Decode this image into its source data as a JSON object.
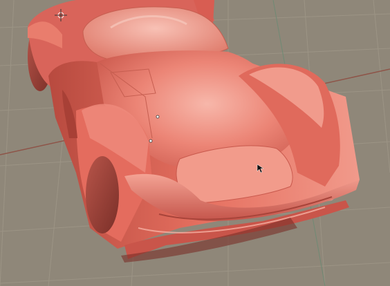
{
  "viewport": {
    "background": "#8f8779",
    "grid_color": "#9c9485",
    "x_axis_color": "#8e5448",
    "y_axis_color": "#6f8a74"
  },
  "scene": {
    "object": "race-car-model",
    "body_color": "#e56a5a",
    "highlight_color": "#f7b4a7",
    "shadow_color": "#a8443a"
  },
  "overlays": {
    "cursor": "arrow-cursor-icon",
    "origin_gizmo": "3d-cursor-icon",
    "vertex_markers": [
      "vertex-point",
      "vertex-point"
    ]
  }
}
